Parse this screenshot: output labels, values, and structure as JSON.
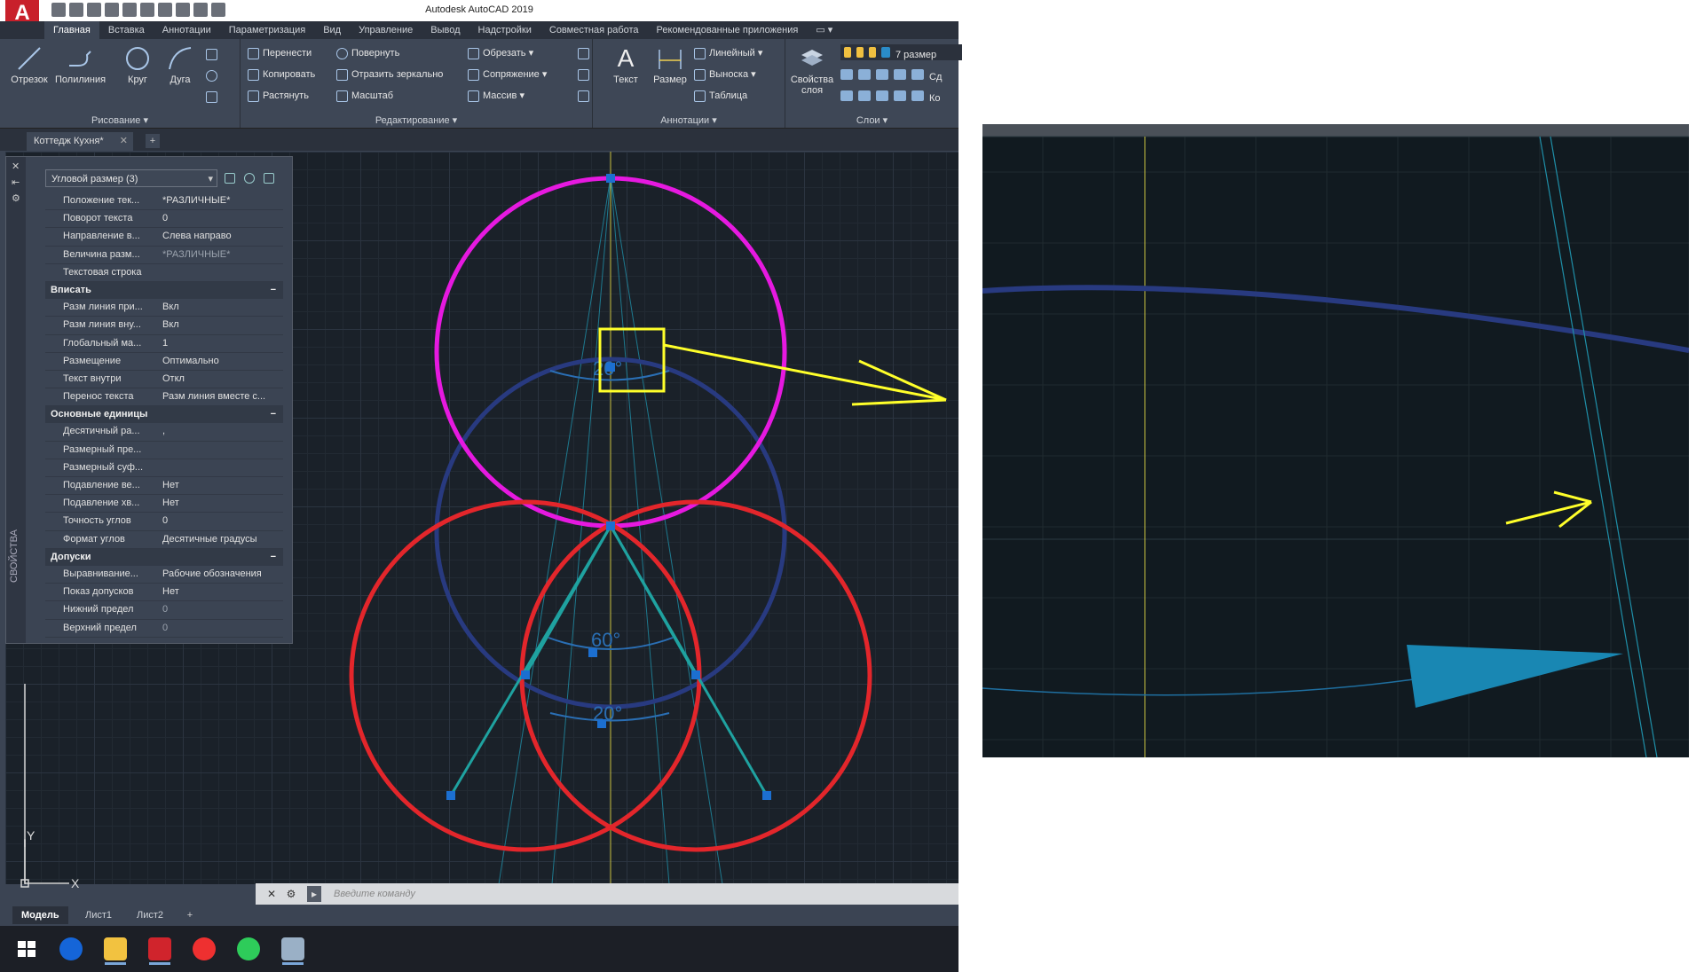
{
  "window": {
    "title": "Autodesk AutoCAD 2019",
    "app_logo": "A"
  },
  "ribbon_tabs": [
    {
      "label": "Главная",
      "active": true
    },
    {
      "label": "Вставка"
    },
    {
      "label": "Аннотации"
    },
    {
      "label": "Параметризация"
    },
    {
      "label": "Вид"
    },
    {
      "label": "Управление"
    },
    {
      "label": "Вывод"
    },
    {
      "label": "Надстройки"
    },
    {
      "label": "Совместная работа"
    },
    {
      "label": "Рекомендованные приложения"
    }
  ],
  "ribbon": {
    "draw": {
      "title": "Рисование ▾",
      "line": "Отрезок",
      "polyline": "Полилиния",
      "circle": "Круг",
      "arc": "Дуга"
    },
    "modify": {
      "title": "Редактирование ▾",
      "move": "Перенести",
      "rotate": "Повернуть",
      "trim": "Обрезать ▾",
      "copy": "Копировать",
      "mirror": "Отразить зеркально",
      "fillet": "Сопряжение ▾",
      "stretch": "Растянуть",
      "scale": "Масштаб",
      "array": "Массив ▾"
    },
    "annotation": {
      "title": "Аннотации ▾",
      "text": "Текст",
      "dimension": "Размер",
      "linear": "Линейный ▾",
      "leader": "Выноска ▾",
      "table": "Таблица"
    },
    "layers": {
      "title": "Слои ▾",
      "props_line1": "Свойства",
      "props_line2": "слоя",
      "current": "7 размер",
      "s1": "Сд",
      "s2": "Ко"
    }
  },
  "doc_tab": {
    "label": "Коттедж Кухня*",
    "close": "✕",
    "new": "+"
  },
  "properties": {
    "side_title": "СВОЙСТВА",
    "selection": "Угловой размер (3)",
    "rows_top": [
      {
        "k": "Положение тек...",
        "v": "*РАЗЛИЧНЫЕ*"
      },
      {
        "k": "Поворот текста",
        "v": "0"
      },
      {
        "k": "Направление в...",
        "v": "Слева направо"
      },
      {
        "k": "Величина разм...",
        "v": "*РАЗЛИЧНЫЕ*"
      },
      {
        "k": "Текстовая строка",
        "v": ""
      }
    ],
    "sec_fit": "Вписать",
    "rows_fit": [
      {
        "k": "Разм линия при...",
        "v": "Вкл"
      },
      {
        "k": "Разм линия вну...",
        "v": "Вкл"
      },
      {
        "k": "Глобальный ма...",
        "v": "1"
      },
      {
        "k": "Размещение",
        "v": "Оптимально"
      },
      {
        "k": "Текст внутри",
        "v": "Откл"
      },
      {
        "k": "Перенос текста",
        "v": "Разм линия вместе с..."
      }
    ],
    "sec_units": "Основные единицы",
    "rows_units": [
      {
        "k": "Десятичный ра...",
        "v": ","
      },
      {
        "k": "Размерный пре...",
        "v": ""
      },
      {
        "k": "Размерный суф...",
        "v": ""
      },
      {
        "k": "Подавление ве...",
        "v": "Нет"
      },
      {
        "k": "Подавление хв...",
        "v": "Нет"
      },
      {
        "k": "Точность углов",
        "v": "0"
      },
      {
        "k": "Формат углов",
        "v": "Десятичные градусы"
      }
    ],
    "sec_tol": "Допуски",
    "rows_tol": [
      {
        "k": "Выравнивание...",
        "v": "Рабочие обозначения"
      },
      {
        "k": "Показ допусков",
        "v": "Нет"
      },
      {
        "k": "Нижний предел",
        "v": "0"
      },
      {
        "k": "Верхний предел",
        "v": "0"
      }
    ],
    "collapse": "−"
  },
  "drawing": {
    "dim_labels": [
      "20°",
      "60°",
      "20°"
    ],
    "ucs_x": "X",
    "ucs_y": "Y",
    "colors": {
      "magenta": "#e619e0",
      "red": "#e3262b",
      "navy": "#283a80",
      "teal": "#1fa2a0",
      "yellow": "#ffff2a",
      "dim": "#2a6fb5"
    }
  },
  "command": {
    "placeholder": "Введите команду",
    "close": "✕",
    "wrench": "🔧",
    "prompt": "▸"
  },
  "layout_tabs": [
    {
      "label": "Модель",
      "active": true
    },
    {
      "label": "Лист1"
    },
    {
      "label": "Лист2"
    }
  ],
  "layout_plus": "+",
  "taskbar": [
    "windows-icon",
    "arrow-up-icon",
    "folder-icon",
    "autocad-icon",
    "yandex-icon",
    "whatsapp-icon",
    "paint-icon"
  ]
}
